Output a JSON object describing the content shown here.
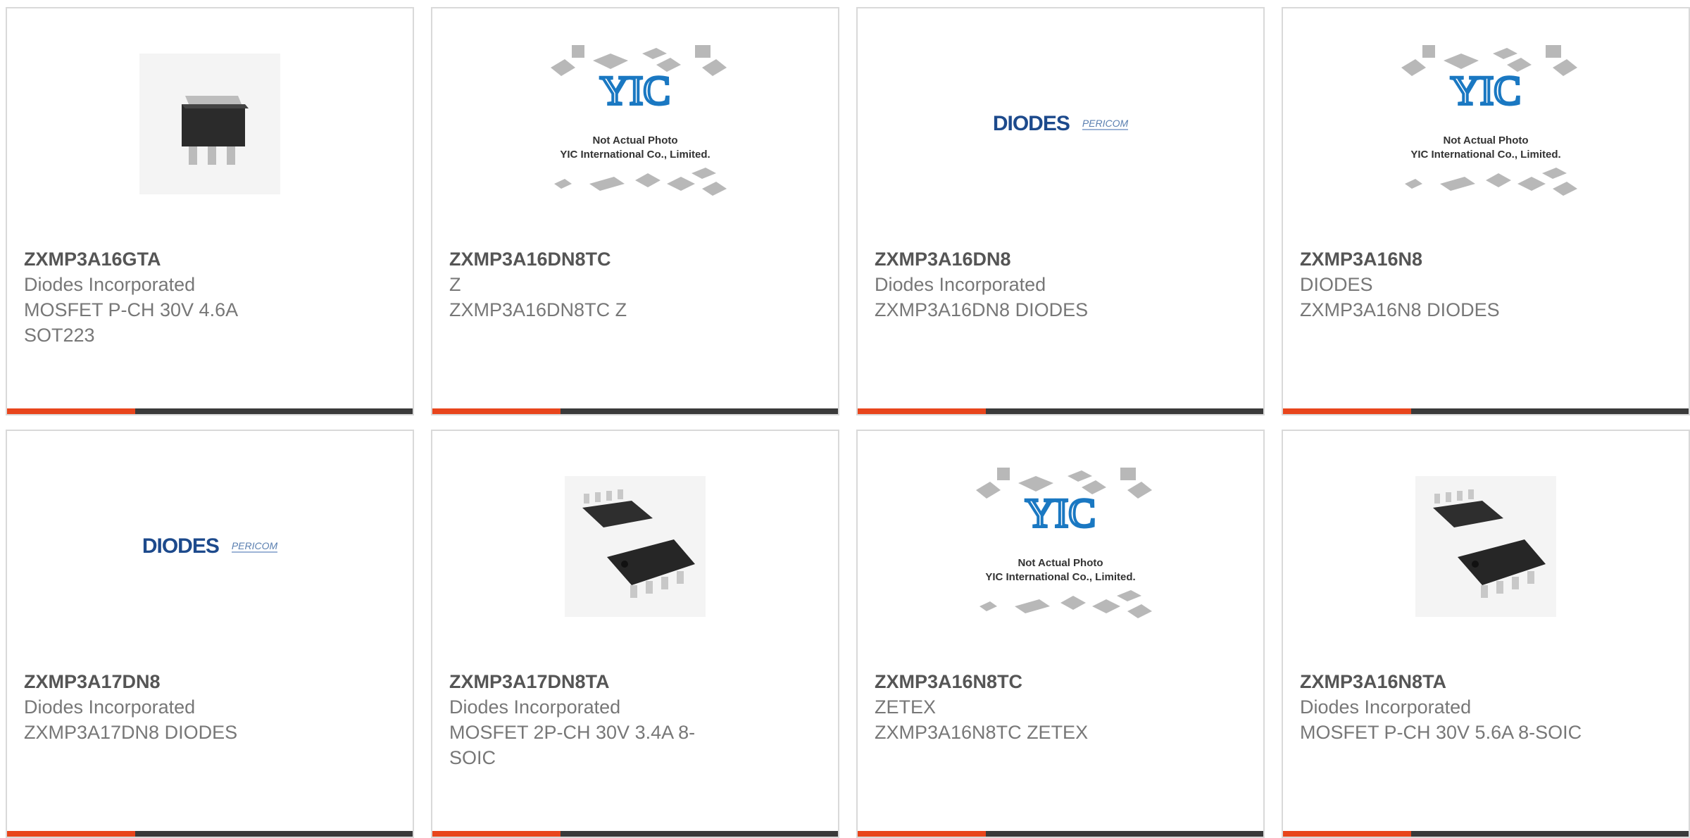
{
  "products": [
    {
      "part": "ZXMP3A16GTA",
      "lines": [
        "Diodes Incorporated",
        "MOSFET P-CH 30V 4.6A",
        "SOT223"
      ],
      "image": "sot223-chip"
    },
    {
      "part": "ZXMP3A16DN8TC",
      "lines": [
        "Z",
        "ZXMP3A16DN8TC Z"
      ],
      "image": "yic-placeholder"
    },
    {
      "part": "ZXMP3A16DN8",
      "lines": [
        "Diodes Incorporated",
        "ZXMP3A16DN8 DIODES"
      ],
      "image": "diodes-logo"
    },
    {
      "part": "ZXMP3A16N8",
      "lines": [
        "DIODES",
        "ZXMP3A16N8 DIODES"
      ],
      "image": "yic-placeholder"
    },
    {
      "part": "ZXMP3A17DN8",
      "lines": [
        "Diodes Incorporated",
        "ZXMP3A17DN8 DIODES"
      ],
      "image": "diodes-logo"
    },
    {
      "part": "ZXMP3A17DN8TA",
      "lines": [
        "Diodes Incorporated",
        "MOSFET 2P-CH 30V 3.4A 8-",
        "SOIC"
      ],
      "image": "soic8-chip"
    },
    {
      "part": "ZXMP3A16N8TC",
      "lines": [
        "ZETEX",
        "ZXMP3A16N8TC ZETEX"
      ],
      "image": "yic-placeholder"
    },
    {
      "part": "ZXMP3A16N8TA",
      "lines": [
        "Diodes Incorporated",
        "MOSFET P-CH 30V 5.6A 8-SOIC"
      ],
      "image": "soic8-chip"
    }
  ],
  "placeholder": {
    "line1": "Not Actual Photo",
    "line2": "YIC International Co., Limited.",
    "logo": "YIC"
  },
  "logo": {
    "diodes": "DIODES",
    "pericom": "PERICOM"
  },
  "colors": {
    "accent": "#e8451c",
    "bar": "#3a3a3a",
    "border": "#d9d9d9",
    "title": "#555555",
    "text": "#777777"
  }
}
